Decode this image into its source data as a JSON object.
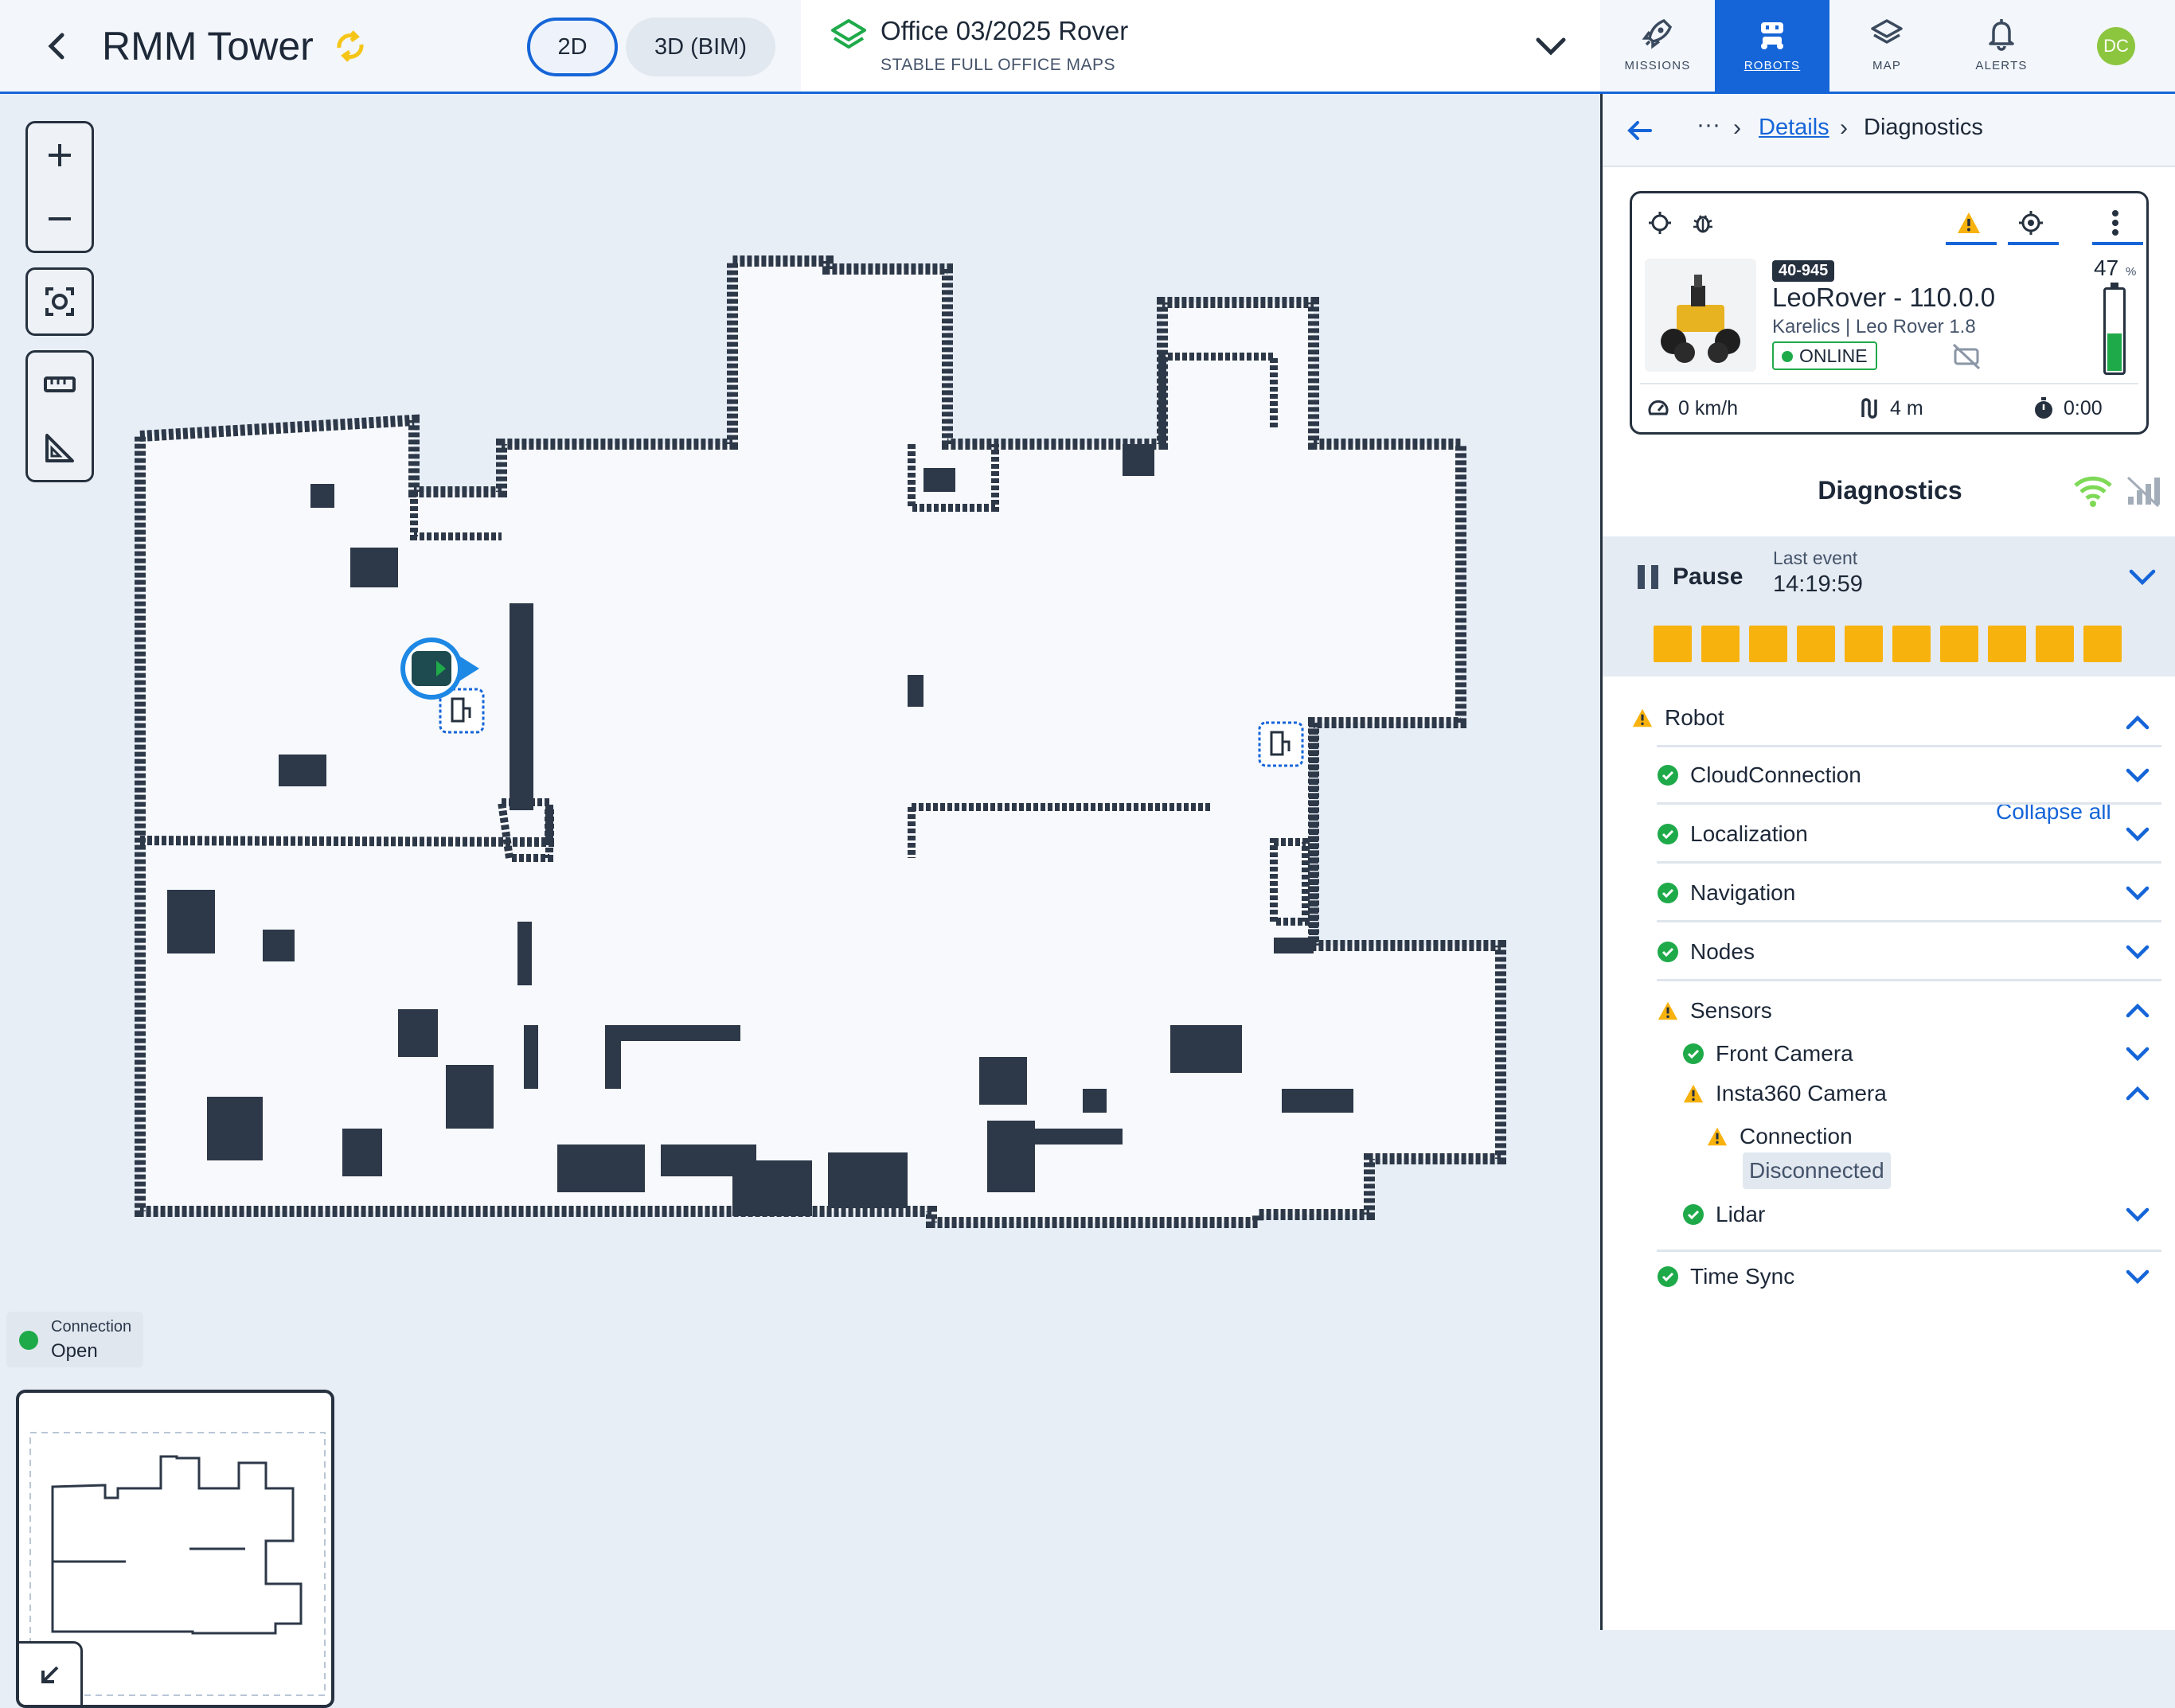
{
  "topbar": {
    "title": "RMM Tower",
    "view_2d": "2D",
    "view_3d": "3D (BIM)",
    "map_name": "Office 03/2025 Rover",
    "map_subtitle": "STABLE FULL OFFICE MAPS",
    "nav": [
      {
        "label": "MISSIONS",
        "icon": "rocket-icon"
      },
      {
        "label": "ROBOTS",
        "icon": "robot-icon",
        "active": true
      },
      {
        "label": "MAP",
        "icon": "layers-icon"
      },
      {
        "label": "ALERTS",
        "icon": "bell-icon"
      }
    ],
    "avatar": "DC"
  },
  "map": {
    "connection_label": "Connection",
    "connection_value": "Open"
  },
  "panel": {
    "breadcrumb": {
      "more": "···",
      "parent": "Details",
      "current": "Diagnostics"
    },
    "robot": {
      "id": "40-945",
      "name": "LeoRover - 110.0.0",
      "model": "Karelics | Leo Rover 1.8",
      "status": "ONLINE",
      "battery": "47",
      "battery_unit": "%",
      "battery_level": 0.47,
      "speed": "0 km/h",
      "distance": "4 m",
      "time": "0:00"
    },
    "diagnostics_title": "Diagnostics",
    "pause_label": "Pause",
    "last_event_label": "Last event",
    "last_event_time": "14:19:59",
    "event_bars": 10,
    "tree": {
      "root": "Robot",
      "collapse_all": "Collapse all",
      "items": {
        "cloud": "CloudConnection",
        "localization": "Localization",
        "navigation": "Navigation",
        "nodes": "Nodes",
        "sensors": "Sensors",
        "front_camera": "Front Camera",
        "insta360": "Insta360 Camera",
        "connection": "Connection",
        "disconnected": "Disconnected",
        "lidar": "Lidar",
        "time_sync": "Time Sync"
      }
    }
  },
  "colors": {
    "accent": "#1565d8",
    "ok": "#1faa4a",
    "warn": "#f8b20e",
    "wall": "#2d3848"
  }
}
